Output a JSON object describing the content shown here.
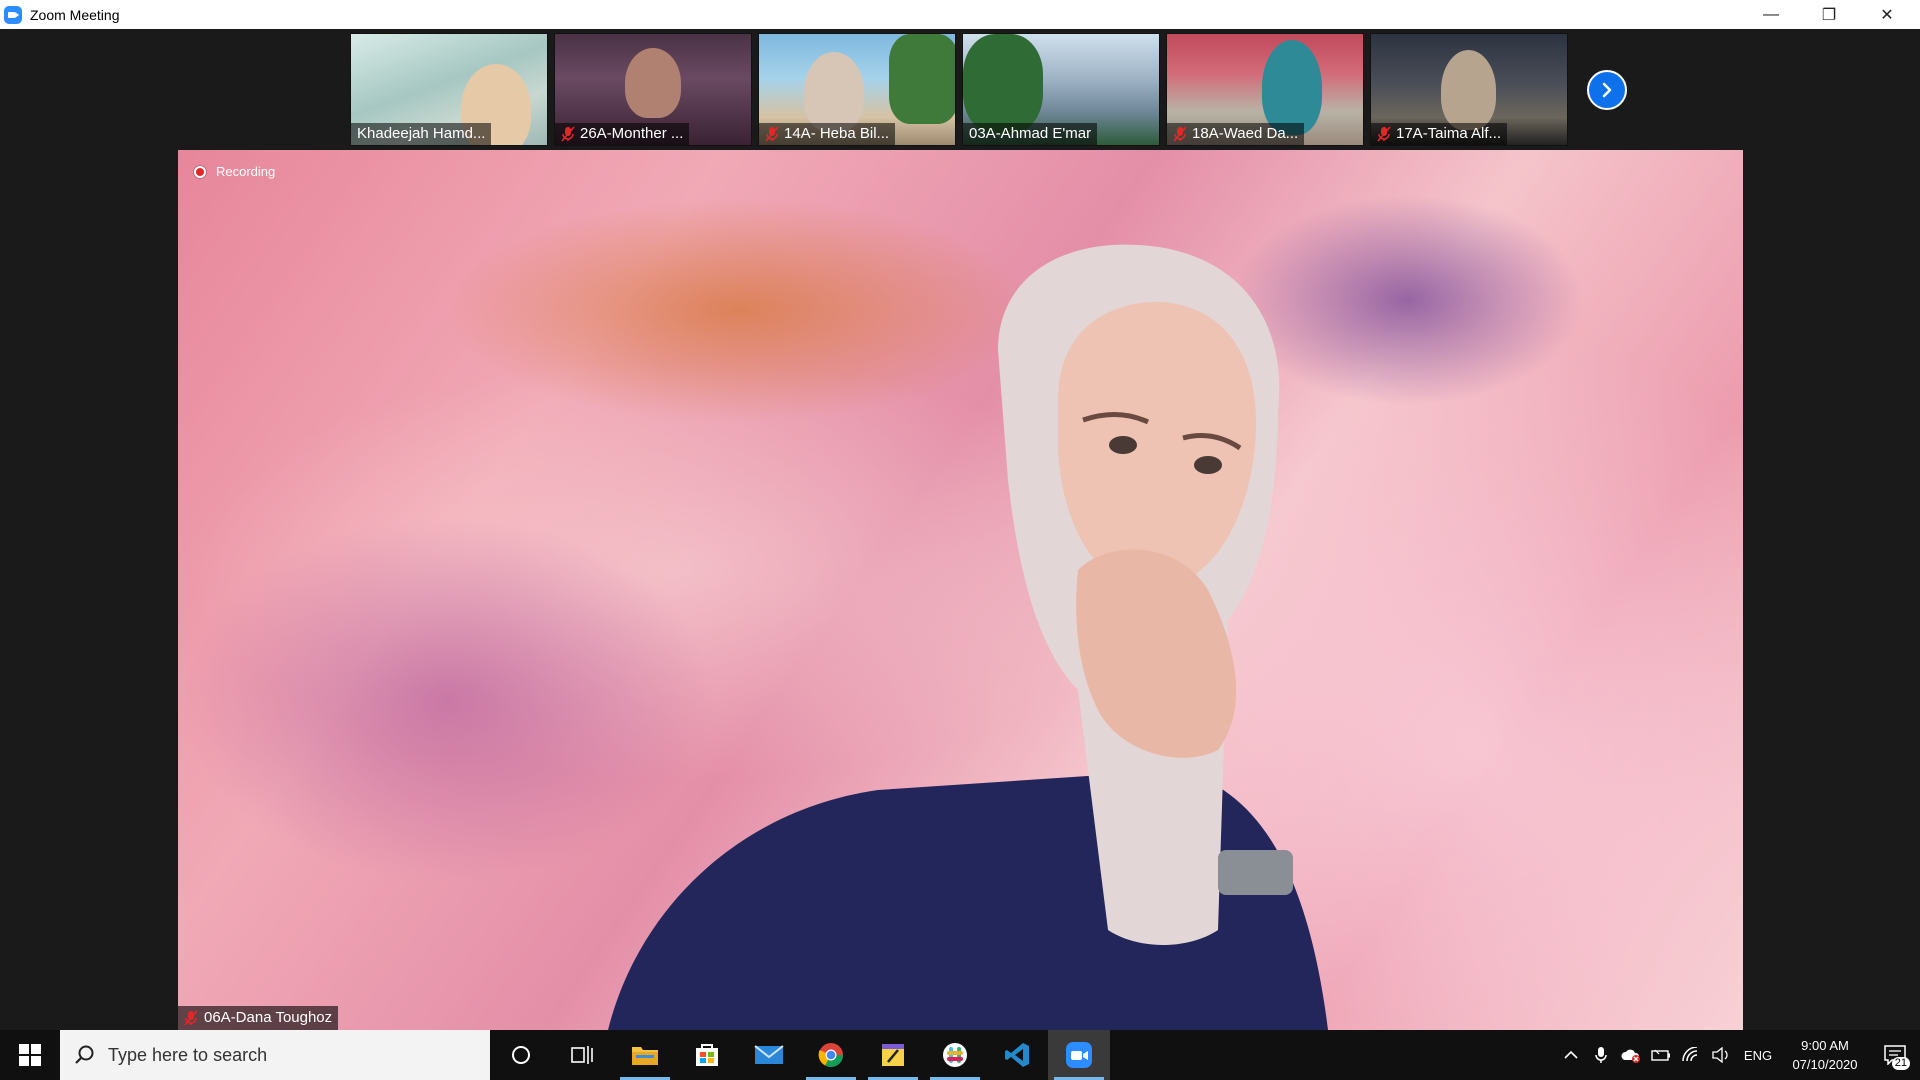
{
  "window": {
    "title": "Zoom Meeting",
    "icon": "zoom-icon",
    "controls": {
      "minimize": "—",
      "maximize": "❐",
      "close": "✕"
    }
  },
  "thumbnails": [
    {
      "name": "Khadeejah Hamd...",
      "muted": false
    },
    {
      "name": "26A-Monther ...",
      "muted": true
    },
    {
      "name": "14A- Heba Bil...",
      "muted": true
    },
    {
      "name": "03A-Ahmad E'mar",
      "muted": false
    },
    {
      "name": "18A-Waed Da...",
      "muted": true
    },
    {
      "name": "17A-Taima Alf...",
      "muted": true
    }
  ],
  "next_page_icon": "chevron-right-icon",
  "main_video": {
    "recording_label": "Recording",
    "speaker_name": "06A-Dana Toughoz",
    "speaker_muted": true
  },
  "taskbar": {
    "search_placeholder": "Type here to search",
    "pinned": [
      "cortana-icon",
      "task-view-icon",
      "file-explorer-icon",
      "store-icon",
      "mail-icon",
      "chrome-icon",
      "sticky-notes-icon",
      "slack-icon",
      "vscode-icon",
      "zoom-icon"
    ],
    "tray": {
      "language": "ENG",
      "time": "9:00 AM",
      "date": "07/10/2020",
      "notification_count": "21"
    }
  },
  "colors": {
    "zoom_blue": "#0e71eb",
    "muted_red": "#e02828",
    "taskbar": "#101010"
  }
}
